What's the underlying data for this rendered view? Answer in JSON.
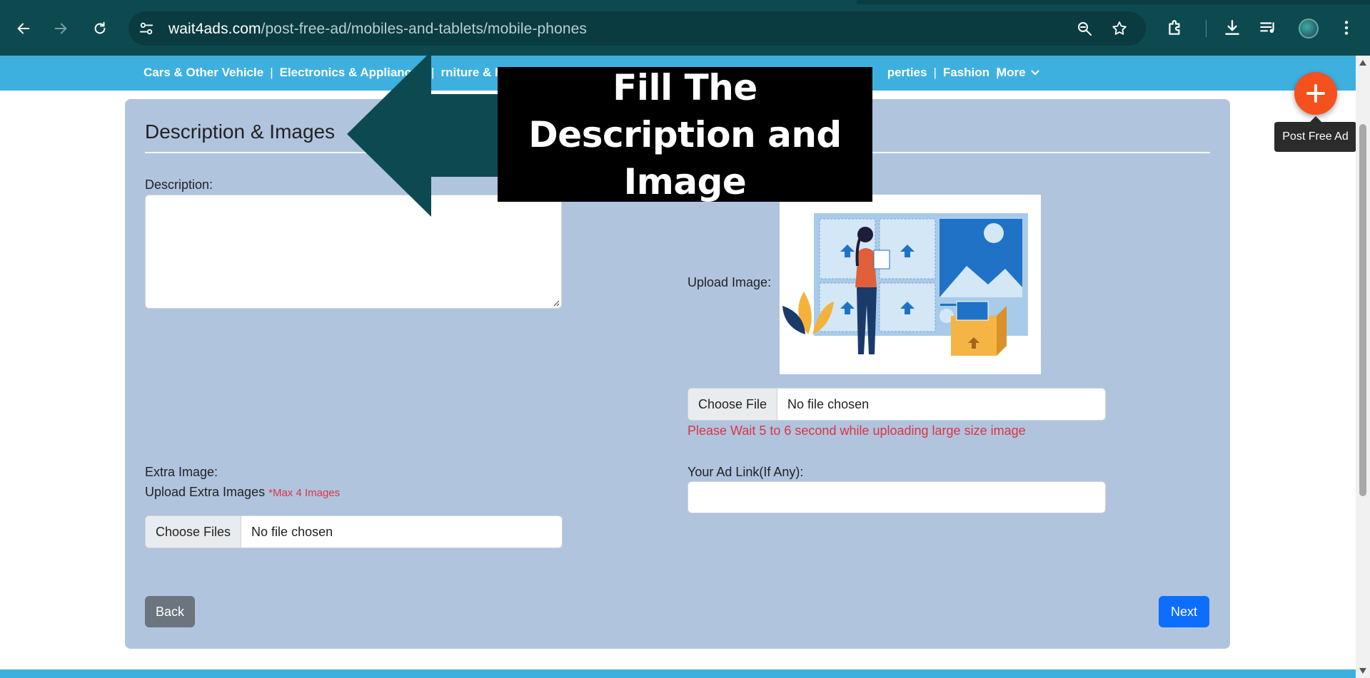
{
  "browser": {
    "url_host": "wait4ads.com",
    "url_path": "/post-free-ad/mobiles-and-tablets/mobile-phones",
    "icons": [
      "back-icon",
      "forward-icon",
      "reload-icon",
      "site-info-icon",
      "zoom-icon",
      "star-icon",
      "extensions-icon",
      "download-icon",
      "media-control-icon",
      "profile-avatar",
      "menu-icon"
    ]
  },
  "categories": {
    "items": [
      "Cars & Other Vehicle",
      "Electronics & Appliances",
      "Furniture & Ho",
      "",
      "perties",
      "Fashion"
    ],
    "visible_left": [
      "Cars & Other Vehicle",
      "Electronics & Appliances"
    ],
    "partial_1": "rniture & Ho",
    "partial_2": "perties",
    "fashion": "Fashion",
    "more": "More"
  },
  "fab": {
    "tooltip": "Post Free Ad",
    "color": "#f4511e"
  },
  "form": {
    "section_title": "Description & Images",
    "description_label": "Description:",
    "description_value": "",
    "upload_image_label": "Upload Image:",
    "choose_file": "Choose File",
    "no_file": "No file chosen",
    "upload_warning": "Please Wait 5 to 6 second while uploading large size image",
    "extra_image_label": "Extra Image:",
    "extra_upload_label": "Upload Extra Images",
    "extra_max_note": "*Max 4 Images",
    "choose_files": "Choose Files",
    "no_files": "No file chosen",
    "ad_link_label": "Your Ad Link(If Any):",
    "ad_link_value": "",
    "back": "Back",
    "next": "Next"
  },
  "overlay": {
    "text": "Fill The Description and Image"
  },
  "colors": {
    "chrome": "#0d4a50",
    "category_bar": "#3eb0e0",
    "card": "#b0c4de",
    "primary": "#0d6efd",
    "secondary": "#6c757d",
    "danger": "#dc3545"
  }
}
